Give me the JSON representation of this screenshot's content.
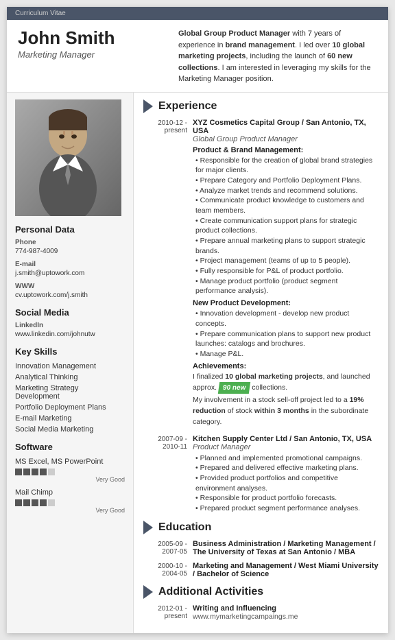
{
  "header_bar": {
    "label": "Curriculum Vitae"
  },
  "header": {
    "name": "John Smith",
    "title": "Marketing Manager",
    "summary": "Global Group Product Manager with 7 years of experience in brand management. I led over 10 global marketing projects, including the launch of 60 new collections. I am interested in leveraging my skills for the Marketing Manager position."
  },
  "sidebar": {
    "personal_data_title": "Personal Data",
    "phone_label": "Phone",
    "phone": "774-987-4009",
    "email_label": "E-mail",
    "email": "j.smith@uptowork.com",
    "www_label": "WWW",
    "www": "cv.uptowork.com/j.smith",
    "social_media_title": "Social Media",
    "linkedin_label": "LinkedIn",
    "linkedin": "www.linkedin.com/johnutw",
    "skills_title": "Key Skills",
    "skills": [
      "Innovation Management",
      "Analytical Thinking",
      "Marketing Strategy Development",
      "Portfolio Deployment Plans",
      "E-mail Marketing",
      "Social Media Marketing"
    ],
    "software_title": "Software",
    "software_items": [
      {
        "name": "MS Excel, MS PowerPoint",
        "rating": 4,
        "max": 5,
        "label": "Very Good"
      },
      {
        "name": "Mail Chimp",
        "rating": 4,
        "max": 5,
        "label": "Very Good"
      }
    ]
  },
  "experience": {
    "section_title": "Experience",
    "entries": [
      {
        "dates": "2010-12 - present",
        "company": "XYZ Cosmetics Capital Group / San Antonio, TX, USA",
        "role": "Global Group Product Manager",
        "subsections": [
          {
            "title": "Product & Brand Management:",
            "bullets": [
              "Responsible for the creation of global brand strategies for major clients.",
              "Prepare Category and Portfolio Deployment Plans.",
              "Analyze market trends and recommend solutions.",
              "Communicate product knowledge to customers and team members.",
              "Create communication support plans for strategic product collections.",
              "Prepare annual marketing plans to support strategic brands.",
              "Project management (teams of up to 5 people).",
              "Fully responsible for P&L of product portfolio.",
              "Manage product portfolio (product segment performance analysis)."
            ]
          },
          {
            "title": "New Product Development:",
            "bullets": [
              "Innovation development - develop new product concepts.",
              "Prepare communication plans to support new product launches: catalogs and brochures.",
              "Manage P&L."
            ]
          },
          {
            "title": "Achievements:",
            "bullets": []
          }
        ],
        "achievement_text": "I finalized 10 global marketing projects, and launched approx. 90 new collections.",
        "achievement_text2": "My involvement in a stock sell-off project led to a 19% reduction of stock within 3 months in the subordinate category."
      },
      {
        "dates": "2007-09 - 2010-11",
        "company": "Kitchen Supply Center Ltd / San Antonio, TX, USA",
        "role": "Product Manager",
        "bullets": [
          "Planned and implemented promotional campaigns.",
          "Prepared and delivered effective marketing plans.",
          "Provided product portfolios and competitive environment analyses.",
          "Responsible for product portfolio forecasts.",
          "Prepared product segment performance analyses."
        ]
      }
    ]
  },
  "education": {
    "section_title": "Education",
    "entries": [
      {
        "dates": "2005-09 - 2007-05",
        "degree": "Business Administration / Marketing Management / The University of Texas at San Antonio / MBA"
      },
      {
        "dates": "2000-10 - 2004-05",
        "degree": "Marketing and Management / West Miami University / Bachelor of Science"
      }
    ]
  },
  "additional": {
    "section_title": "Additional Activities",
    "entries": [
      {
        "dates": "2012-01 - present",
        "title": "Writing and Influencing",
        "link": "www.mymarketingcampaings.me"
      }
    ]
  }
}
